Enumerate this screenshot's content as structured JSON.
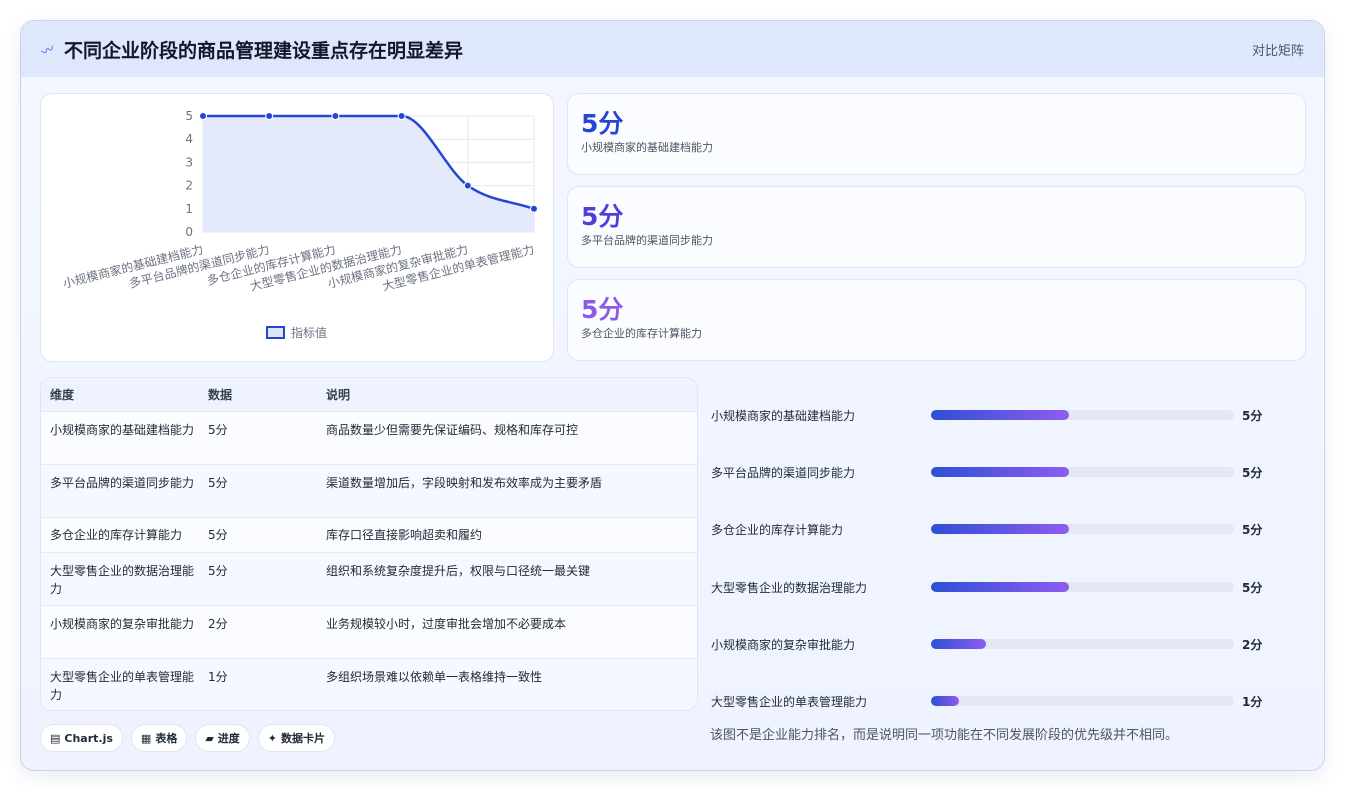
{
  "header": {
    "icon": "sparkline-icon",
    "title": "不同企业阶段的商品管理建设重点存在明显差异",
    "tag": "对比矩阵"
  },
  "chart_data": {
    "type": "line",
    "categories": [
      "小规模商家的基础建档能力",
      "多平台品牌的渠道同步能力",
      "多仓企业的库存计算能力",
      "大型零售企业的数据治理能力",
      "小规模商家的复杂审批能力",
      "大型零售企业的单表管理能力"
    ],
    "series": [
      {
        "name": "指标值",
        "values": [
          5,
          5,
          5,
          5,
          2,
          1
        ]
      }
    ],
    "ylim": [
      0,
      5
    ],
    "yticks": [
      "0",
      "1",
      "2",
      "3",
      "4",
      "5"
    ],
    "legend": "bottom",
    "colors": {
      "line": "#2446d0",
      "fill": "#dfe6fa"
    }
  },
  "kpis": [
    {
      "value": "5分",
      "label": "小规模商家的基础建档能力",
      "color": "#2446d0"
    },
    {
      "value": "5分",
      "label": "多平台品牌的渠道同步能力",
      "color": "#4f3fd9"
    },
    {
      "value": "5分",
      "label": "多仓企业的库存计算能力",
      "color": "#8b5be6"
    }
  ],
  "table": {
    "headers": [
      "维度",
      "数据",
      "说明"
    ],
    "rows": [
      {
        "dim": "小规模商家的基础建档能力",
        "val": "5分",
        "desc": "商品数量少但需要先保证编码、规格和库存可控"
      },
      {
        "dim": "多平台品牌的渠道同步能力",
        "val": "5分",
        "desc": "渠道数量增加后，字段映射和发布效率成为主要矛盾"
      },
      {
        "dim": "多仓企业的库存计算能力",
        "val": "5分",
        "desc": "库存口径直接影响超卖和履约"
      },
      {
        "dim": "大型零售企业的数据治理能力",
        "val": "5分",
        "desc": "组织和系统复杂度提升后，权限与口径统一最关键"
      },
      {
        "dim": "小规模商家的复杂审批能力",
        "val": "2分",
        "desc": "业务规模较小时，过度审批会增加不必要成本"
      },
      {
        "dim": "大型零售企业的单表管理能力",
        "val": "1分",
        "desc": "多组织场景难以依赖单一表格维持一致性"
      }
    ]
  },
  "progress": [
    {
      "label": "小规模商家的基础建档能力",
      "value": "5分",
      "fraction": 0.455
    },
    {
      "label": "多平台品牌的渠道同步能力",
      "value": "5分",
      "fraction": 0.455
    },
    {
      "label": "多仓企业的库存计算能力",
      "value": "5分",
      "fraction": 0.455
    },
    {
      "label": "大型零售企业的数据治理能力",
      "value": "5分",
      "fraction": 0.455
    },
    {
      "label": "小规模商家的复杂审批能力",
      "value": "2分",
      "fraction": 0.182
    },
    {
      "label": "大型零售企业的单表管理能力",
      "value": "1分",
      "fraction": 0.091
    }
  ],
  "note": "该图不是企业能力排名，而是说明同一项功能在不同发展阶段的优先级并不相同。",
  "pills": [
    {
      "icon": "chart-icon",
      "glyph": "▤",
      "label": "Chart.js"
    },
    {
      "icon": "table-icon",
      "glyph": "▦",
      "label": "表格"
    },
    {
      "icon": "progress-icon",
      "glyph": "▰",
      "label": "进度"
    },
    {
      "icon": "sparkle-icon",
      "glyph": "✦",
      "label": "数据卡片"
    }
  ]
}
